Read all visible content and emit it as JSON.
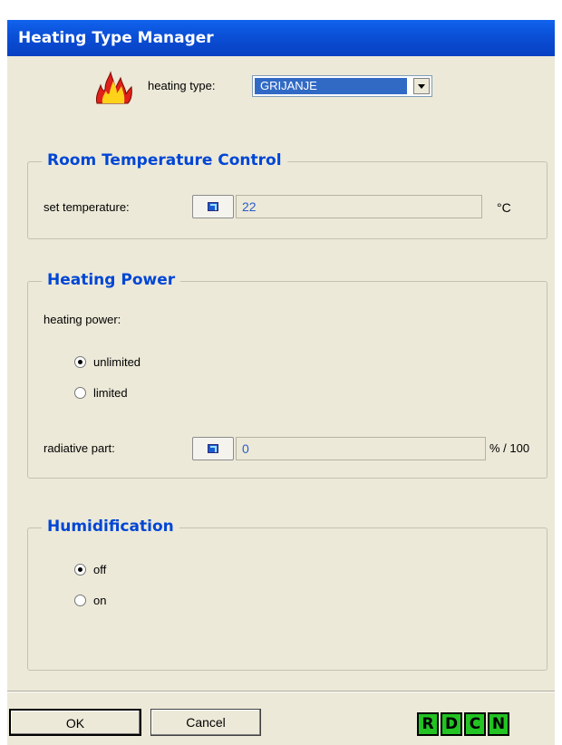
{
  "window": {
    "title": "Heating Type Manager"
  },
  "heating_type": {
    "label": "heating type:",
    "value": "GRIJANJE",
    "icon": "flame-icon"
  },
  "room_temp": {
    "title": "Room Temperature Control",
    "set_label": "set temperature:",
    "value": "22",
    "unit": "°C"
  },
  "heating_power": {
    "title": "Heating Power",
    "label": "heating power:",
    "options": [
      {
        "label": "unlimited",
        "selected": true
      },
      {
        "label": "limited",
        "selected": false
      }
    ],
    "radiative_label": "radiative part:",
    "radiative_value": "0",
    "radiative_unit": "% / 100"
  },
  "humidification": {
    "title": "Humidification",
    "options": [
      {
        "label": "off",
        "selected": true
      },
      {
        "label": "on",
        "selected": false
      }
    ]
  },
  "footer": {
    "ok_label": "OK",
    "cancel_label": "Cancel",
    "letter_buttons": [
      "R",
      "D",
      "C",
      "N"
    ]
  },
  "colors": {
    "title_bar": "#0a4fd6",
    "group_title": "#0046d5",
    "letter_buttons": "#22c322"
  }
}
